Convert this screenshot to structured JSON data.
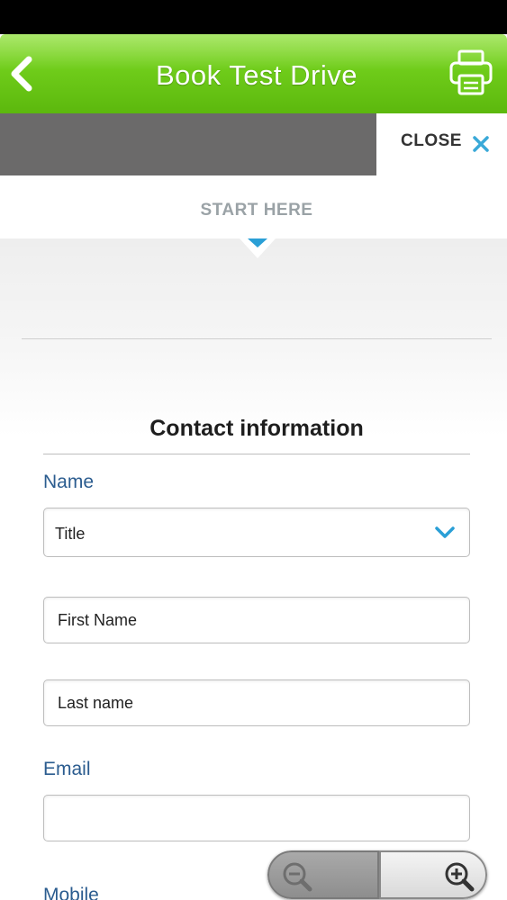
{
  "header": {
    "title": "Book Test Drive",
    "back_icon": "chevron-left-icon",
    "print_icon": "printer-icon",
    "color": "#6fcc1a"
  },
  "tabs": {
    "close_label": "CLOSE",
    "close_icon": "close-icon",
    "close_icon_color": "#3aa9d8"
  },
  "steps": {
    "start_label": "START HERE",
    "indicator_color": "#2a9fd6"
  },
  "form": {
    "section_title": "Contact information",
    "name_label": "Name",
    "title_select_value": "Title",
    "first_name_placeholder": "First Name",
    "last_name_placeholder": "Last name",
    "email_label": "Email",
    "email_value": "",
    "mobile_label": "Mobile",
    "label_color": "#2b5c8f"
  },
  "zoom": {
    "zoom_out_icon": "zoom-out-icon",
    "zoom_in_icon": "zoom-in-icon"
  }
}
